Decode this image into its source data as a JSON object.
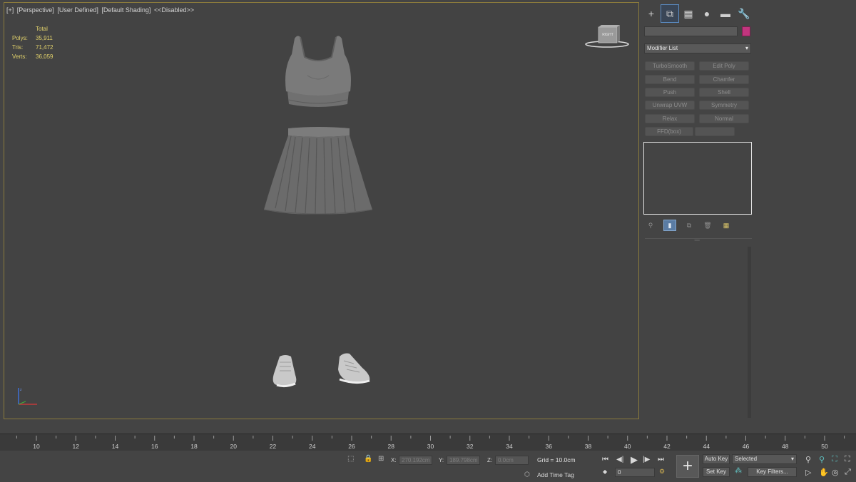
{
  "viewport": {
    "labels": [
      "[+]",
      "[Perspective]",
      "[User Defined]",
      "[Default Shading]",
      "<<Disabled>>"
    ],
    "stats": {
      "header": "Total",
      "rows": [
        {
          "label": "Polys:",
          "value": "35,911"
        },
        {
          "label": "Tris:",
          "value": "71,472"
        },
        {
          "label": "Verts:",
          "value": "36,059"
        }
      ]
    },
    "viewcube_label": "RIGHT"
  },
  "command_panel": {
    "tabs": [
      {
        "icon": "create-icon",
        "glyph": "+"
      },
      {
        "icon": "modify-icon",
        "glyph": "⧉"
      },
      {
        "icon": "hierarchy-icon",
        "glyph": "▦"
      },
      {
        "icon": "motion-icon",
        "glyph": "●"
      },
      {
        "icon": "display-icon",
        "glyph": "▬"
      },
      {
        "icon": "utilities-icon",
        "glyph": "🔧"
      }
    ],
    "object_name": "",
    "object_color": "#c2357e",
    "modifier_list": "Modifier List",
    "modifier_buttons": [
      {
        "label": "TurboSmooth"
      },
      {
        "label": "Edit Poly"
      },
      {
        "label": "Bend"
      },
      {
        "label": "Chamfer"
      },
      {
        "label": "Push"
      },
      {
        "label": "Shell"
      },
      {
        "label": "Unwrap UVW"
      },
      {
        "label": "Symmetry"
      },
      {
        "label": "Relax"
      },
      {
        "label": "Normal"
      },
      {
        "label": "FFD(box)"
      },
      {
        "label": ""
      }
    ],
    "stack_tools": [
      "pin-stack-icon",
      "show-end-result-icon",
      "make-unique-icon",
      "remove-modifier-icon",
      "configure-modifier-sets-icon"
    ]
  },
  "timeline": {
    "ticks": [
      "10",
      "12",
      "14",
      "16",
      "18",
      "20",
      "22",
      "24",
      "26",
      "28",
      "30",
      "32",
      "34",
      "36",
      "38",
      "40",
      "42",
      "44",
      "46",
      "48",
      "50"
    ]
  },
  "status": {
    "x_label": "X:",
    "x_value": "270.192cm",
    "y_label": "Y:",
    "y_value": "189.798cm",
    "z_label": "Z:",
    "z_value": "0.0cm",
    "grid": "Grid = 10.0cm",
    "time_tag": "Add Time Tag",
    "frame": "0",
    "auto_key": "Auto Key",
    "set_key": "Set Key",
    "selected": "Selected",
    "key_filters": "Key Filters..."
  }
}
